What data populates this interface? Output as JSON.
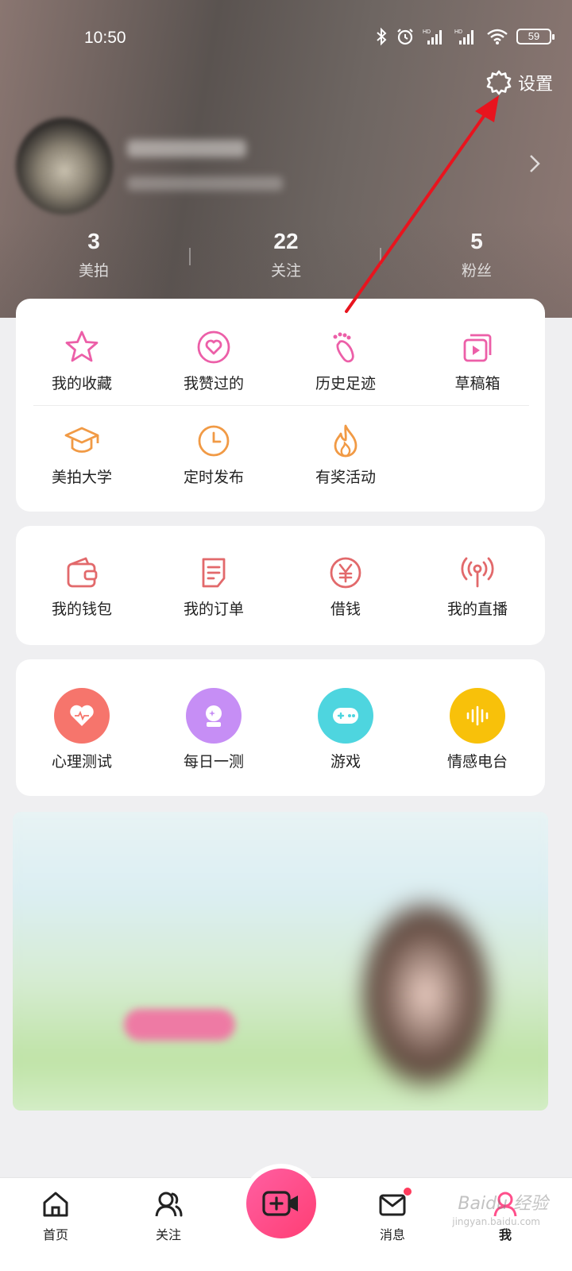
{
  "status_bar": {
    "time": "10:50",
    "battery": "59"
  },
  "settings": {
    "label": "设置",
    "icon": "gear-icon"
  },
  "profile": {
    "avatar": "avatar",
    "chevron_icon": "chevron-right-icon"
  },
  "stats": [
    {
      "value": "3",
      "label": "美拍"
    },
    {
      "value": "22",
      "label": "关注"
    },
    {
      "value": "5",
      "label": "粉丝"
    }
  ],
  "menu_group1": [
    {
      "label": "我的收藏",
      "icon": "star-icon",
      "color": "#ec5fa8"
    },
    {
      "label": "我赞过的",
      "icon": "heart-icon",
      "color": "#ec5fa8"
    },
    {
      "label": "历史足迹",
      "icon": "footprint-icon",
      "color": "#ec5fa8"
    },
    {
      "label": "草稿箱",
      "icon": "drafts-icon",
      "color": "#ec5fa8"
    },
    {
      "label": "美拍大学",
      "icon": "graduation-cap-icon",
      "color": "#f19a45"
    },
    {
      "label": "定时发布",
      "icon": "clock-icon",
      "color": "#f19a45"
    },
    {
      "label": "有奖活动",
      "icon": "flame-icon",
      "color": "#f19a45"
    }
  ],
  "menu_group2": [
    {
      "label": "我的钱包",
      "icon": "wallet-icon",
      "color": "#e2696b"
    },
    {
      "label": "我的订单",
      "icon": "order-icon",
      "color": "#e2696b"
    },
    {
      "label": "借钱",
      "icon": "yuan-icon",
      "color": "#e2696b"
    },
    {
      "label": "我的直播",
      "icon": "broadcast-icon",
      "color": "#e2696b"
    }
  ],
  "menu_group3": [
    {
      "label": "心理测试",
      "icon": "heartbeat-icon",
      "color": "#f6756c"
    },
    {
      "label": "每日一测",
      "icon": "crystal-ball-icon",
      "color": "#c68ef5"
    },
    {
      "label": "游戏",
      "icon": "gamepad-icon",
      "color": "#4ed5df"
    },
    {
      "label": "情感电台",
      "icon": "soundwave-icon",
      "color": "#f8c10a"
    }
  ],
  "bottom_nav": [
    {
      "label": "首页",
      "icon": "home-icon"
    },
    {
      "label": "关注",
      "icon": "users-icon"
    },
    {
      "label": "",
      "icon": "video-add-icon"
    },
    {
      "label": "消息",
      "icon": "mail-icon"
    },
    {
      "label": "我",
      "icon": "profile-icon"
    }
  ],
  "watermark": {
    "text": "Baidu 经验",
    "sub": "jingyan.baidu.com"
  },
  "colors": {
    "accent": "#ff4f8b",
    "annotation": "#e8141e"
  }
}
